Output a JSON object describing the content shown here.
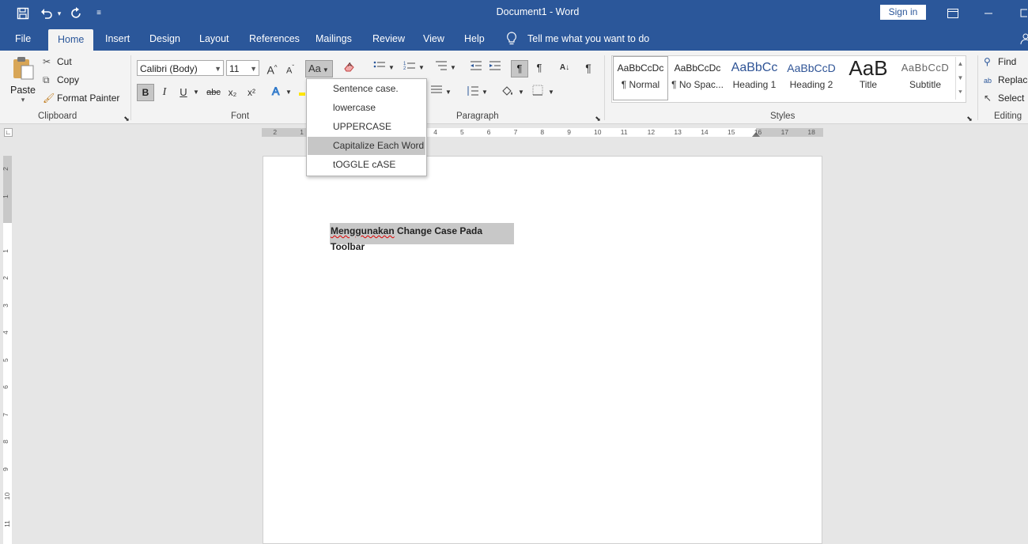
{
  "titlebar": {
    "title": "Document1  -  Word",
    "signin": "Sign in",
    "icons": [
      "save-icon",
      "undo-icon",
      "redo-icon",
      "customize-qat-icon",
      "ribbon-display-icon",
      "minimize-icon",
      "restore-icon"
    ]
  },
  "tabs": [
    "File",
    "Home",
    "Insert",
    "Design",
    "Layout",
    "References",
    "Mailings",
    "Review",
    "View",
    "Help"
  ],
  "active_tab": "Home",
  "tell_me": "Tell me what you want to do",
  "clipboard": {
    "paste": "Paste",
    "cut": "Cut",
    "copy": "Copy",
    "format_painter": "Format Painter",
    "label": "Clipboard"
  },
  "font": {
    "name": "Calibri (Body)",
    "size": "11",
    "change_case": "Aa",
    "grow": "A",
    "shrink": "A",
    "bold": "B",
    "italic": "I",
    "underline": "U",
    "strike": "abc",
    "sub": "x₂",
    "sup": "x²",
    "label": "Font"
  },
  "paragraph": {
    "label": "Paragraph"
  },
  "styles": {
    "label": "Styles",
    "items": [
      {
        "sample": "AaBbCcDc",
        "name": "¶ Normal"
      },
      {
        "sample": "AaBbCcDc",
        "name": "¶ No Spac..."
      },
      {
        "sample": "AaBbCc",
        "name": "Heading 1"
      },
      {
        "sample": "AaBbCcD",
        "name": "Heading 2"
      },
      {
        "sample": "AaB",
        "name": "Title"
      },
      {
        "sample": "AaBbCcD",
        "name": "Subtitle"
      }
    ]
  },
  "editing": {
    "find": "Find",
    "replace": "Replace",
    "select": "Select",
    "label": "Editing"
  },
  "change_case_menu": {
    "items": [
      "Sentence case.",
      "lowercase",
      "UPPERCASE",
      "Capitalize Each Word",
      "tOGGLE cASE"
    ],
    "highlighted": "Capitalize Each Word"
  },
  "ruler_labels": [
    "2",
    "1",
    "1",
    "2",
    "3",
    "4",
    "5",
    "6",
    "7",
    "8",
    "9",
    "10",
    "11",
    "12",
    "13",
    "14",
    "15",
    "16",
    "17",
    "18"
  ],
  "vruler_labels": [
    "2",
    "1",
    "1",
    "2",
    "3",
    "4",
    "5",
    "6",
    "7",
    "8",
    "9",
    "10",
    "11"
  ],
  "document": {
    "text_misspelled": "Menggunakan",
    "text_rest": " Change Case Pada Toolbar"
  }
}
